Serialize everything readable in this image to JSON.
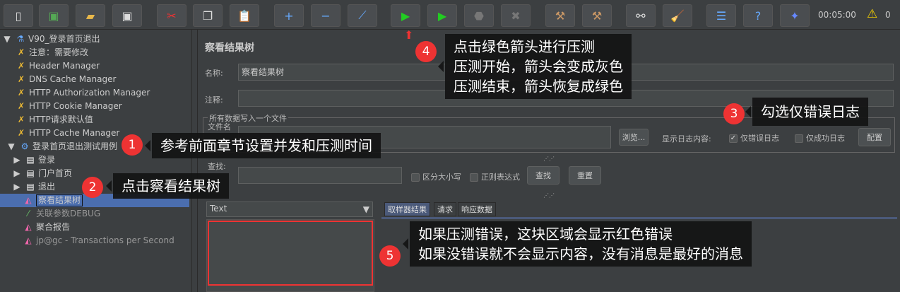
{
  "toolbar": {
    "timer": "00:05:00",
    "warnings": "0",
    "icons": [
      "new-icon",
      "templates-icon",
      "open-icon",
      "save-icon",
      "cut-icon",
      "copy-icon",
      "paste-icon",
      "expand-icon",
      "collapse-icon",
      "toggle-icon",
      "start-icon",
      "start-no-pause-icon",
      "stop-icon",
      "shutdown-icon",
      "clear-icon",
      "clear-all-icon",
      "search-icon",
      "reset-search-icon",
      "function-helper-icon",
      "help-icon",
      "remote-icon"
    ]
  },
  "tree": {
    "items": [
      {
        "label": "V90_登录首页退出"
      },
      {
        "label": "注意：需要修改"
      },
      {
        "label": "Header Manager"
      },
      {
        "label": "DNS Cache Manager"
      },
      {
        "label": "HTTP Authorization Manager"
      },
      {
        "label": "HTTP Cookie Manager"
      },
      {
        "label": "HTTP请求默认值"
      },
      {
        "label": "HTTP Cache Manager"
      },
      {
        "label": "登录首页退出测试用例"
      },
      {
        "label": "登录"
      },
      {
        "label": "门户首页"
      },
      {
        "label": "退出"
      },
      {
        "label": "察看结果树"
      },
      {
        "label": "关联参数DEBUG"
      },
      {
        "label": "聚合报告"
      },
      {
        "label": "jp@gc - Transactions per Second"
      }
    ]
  },
  "panel": {
    "title": "察看结果树",
    "name_label": "名称:",
    "name_value": "察看结果树",
    "comment_label": "注释:",
    "file_group": "所有数据写入一个文件",
    "filename_label": "文件名",
    "browse": "浏览...",
    "log_label": "显示日志内容:",
    "errors_only": "仅错误日志",
    "success_only": "仅成功日志",
    "configure": "配置",
    "search_label": "查找:",
    "case_sensitive": "区分大小写",
    "regex": "正则表达式",
    "find": "查找",
    "reset": "重置",
    "renderer": "Text",
    "tabs": [
      "取样器结果",
      "请求",
      "响应数据"
    ]
  },
  "annotations": [
    {
      "n": "1",
      "text": "参考前面章节设置并发和压测时间"
    },
    {
      "n": "2",
      "text": "点击察看结果树"
    },
    {
      "n": "3",
      "text": "勾选仅错误日志"
    },
    {
      "n": "4",
      "lines": [
        "点击绿色箭头进行压测",
        "压测开始，箭头会变成灰色",
        "压测结束，箭头恢复成绿色"
      ]
    },
    {
      "n": "5",
      "lines": [
        "如果压测错误，这块区域会显示红色错误",
        "如果没错误就不会显示内容，没有消息是最好的消息"
      ]
    }
  ]
}
